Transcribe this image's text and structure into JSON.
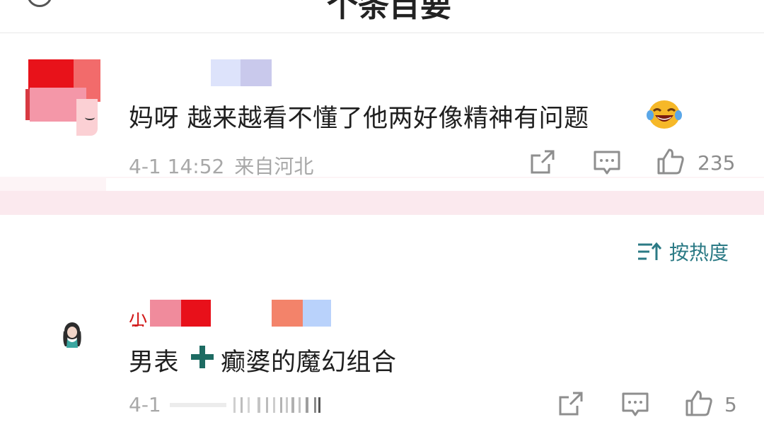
{
  "header": {
    "title": "个条目要"
  },
  "comments": [
    {
      "text": "妈呀 越来越看不懂了他两好像精神有问题",
      "emoji": "laughing-tears-emoji",
      "time": "4-1 14:52",
      "location": "来自河北",
      "likes": "235"
    },
    {
      "name_fragment": "小号",
      "text_before": "男表",
      "text_after": "癫婆的魔幻组合",
      "time": "4-1",
      "likes": "5"
    }
  ],
  "sort": {
    "label": "按热度",
    "icon": "sort-icon"
  },
  "colors": {
    "accent": "#2b7a85",
    "meta": "#a8a8a8",
    "separator": "#fbe9ee"
  }
}
